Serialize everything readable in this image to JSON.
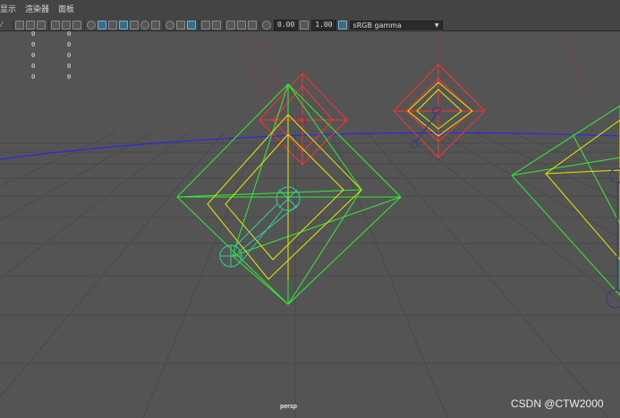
{
  "menubar": {
    "items": [
      "显示",
      "渲染器",
      "面板"
    ]
  },
  "toolbar": {
    "exposure_value": "0.00",
    "gamma_value": "1.00",
    "color_space": "sRGB gamma"
  },
  "hud": {
    "values": [
      [
        "0",
        "0"
      ],
      [
        "0",
        "0"
      ],
      [
        "0",
        "0"
      ],
      [
        "0",
        "0"
      ],
      [
        "0",
        "0"
      ]
    ]
  },
  "viewport": {
    "camera": "persp"
  },
  "watermark": "CSDN @CTW2000",
  "colors": {
    "grid": "#4a4a4a",
    "horizon": "#2020ff",
    "selected_wire": "#33ee33",
    "inner_wire": "#e8e800",
    "locator_wire": "#ff3030",
    "handle_wire": "#30d0a0"
  }
}
